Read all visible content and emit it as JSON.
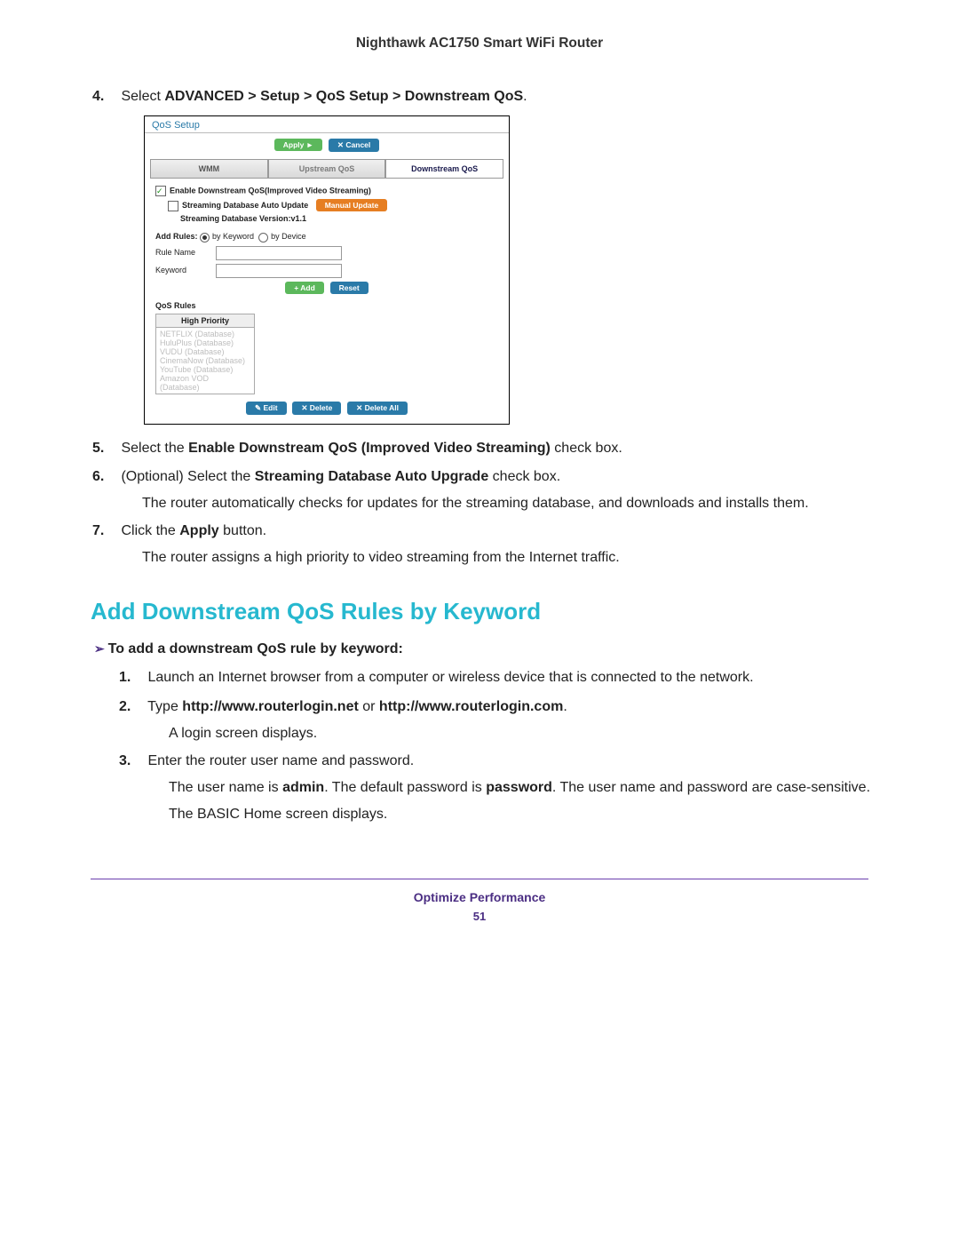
{
  "header": {
    "title": "Nighthawk AC1750 Smart WiFi Router"
  },
  "steps_a": [
    {
      "n": "4.",
      "pre": "Select ",
      "bold": "ADVANCED > Setup > QoS Setup > Downstream QoS",
      "post": "."
    }
  ],
  "shot": {
    "title": "QoS Setup",
    "apply": "Apply  ►",
    "cancel": "✕ Cancel",
    "tabs": {
      "wmm": "WMM",
      "up": "Upstream QoS",
      "down": "Downstream QoS"
    },
    "cb_enable": "Enable Downstream QoS(Improved Video Streaming)",
    "cb_auto": "Streaming Database Auto Update",
    "manual": "Manual Update",
    "version": "Streaming Database Version:v1.1",
    "addrules": "Add Rules:",
    "opt_kw": "by Keyword",
    "opt_dev": "by Device",
    "lbl_rule": "Rule Name",
    "lbl_kw": "Keyword",
    "btn_add": "+ Add",
    "btn_reset": "Reset",
    "qos_rules": "QoS Rules",
    "prio_hdr": "High Priority",
    "prio_items": [
      "NETFLIX (Database)",
      "HuluPlus (Database)",
      "VUDU (Database)",
      "CinemaNow (Database)",
      "YouTube (Database)",
      "Amazon VOD (Database)"
    ],
    "btn_edit": "✎ Edit",
    "btn_del": "✕ Delete",
    "btn_delall": "✕ Delete All"
  },
  "steps_b": [
    {
      "n": "5.",
      "pre": "Select the ",
      "bold": "Enable Downstream QoS (Improved Video Streaming)",
      "post": " check box."
    },
    {
      "n": "6.",
      "pre": "(Optional) Select the ",
      "bold": "Streaming Database Auto Upgrade",
      "post": " check box."
    }
  ],
  "para1": "The router automatically checks for updates for the streaming database, and downloads and installs them.",
  "step7": {
    "n": "7.",
    "pre": "Click the ",
    "bold": "Apply",
    "post": " button."
  },
  "para2": "The router assigns a high priority to video streaming from the Internet traffic.",
  "section": "Add Downstream QoS Rules by Keyword",
  "proc_intro": "To add a downstream QoS rule by keyword:",
  "proc": [
    {
      "n": "1.",
      "text": "Launch an Internet browser from a computer or wireless device that is connected to the network."
    },
    {
      "n": "2.",
      "pre": "Type ",
      "bold": "http://www.routerlogin.net",
      "mid": " or ",
      "bold2": "http://www.routerlogin.com",
      "post": "."
    }
  ],
  "proc_line2a": "A login screen displays.",
  "proc3": {
    "n": "3.",
    "text": "Enter the router user name and password."
  },
  "proc_line3a_pre": "The user name is ",
  "proc_line3a_b1": "admin",
  "proc_line3a_mid": ". The default password is ",
  "proc_line3a_b2": "password",
  "proc_line3a_post": ". The user name and password are case-sensitive.",
  "proc_line3b": "The BASIC Home screen displays.",
  "footer": {
    "label": "Optimize Performance",
    "page": "51"
  }
}
